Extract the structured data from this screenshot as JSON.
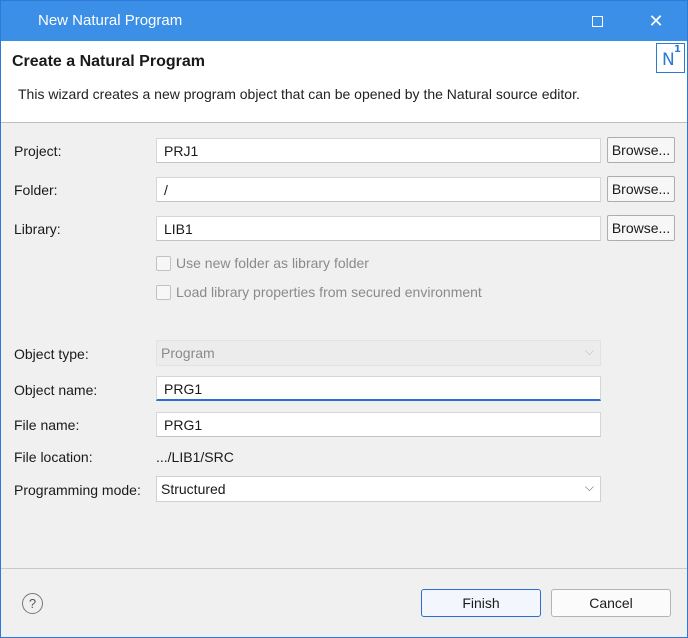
{
  "window": {
    "title": "New Natural Program",
    "close_glyph": "✕"
  },
  "header": {
    "title": "Create a Natural Program",
    "description": "This wizard creates a new program object that can be opened by the Natural source editor.",
    "logo_letter": "N",
    "logo_superscript": "1"
  },
  "form": {
    "project": {
      "label": "Project:",
      "value": "PRJ1",
      "browse_label": "Browse..."
    },
    "folder": {
      "label": "Folder:",
      "value": "/",
      "browse_label": "Browse..."
    },
    "library": {
      "label": "Library:",
      "value": "LIB1",
      "browse_label": "Browse..."
    },
    "use_new_folder": {
      "label": "Use new folder as library folder",
      "checked": false,
      "enabled": false
    },
    "load_library_props": {
      "label": "Load library properties from secured environment",
      "checked": false,
      "enabled": false
    },
    "object_type": {
      "label": "Object type:",
      "value": "Program",
      "enabled": false
    },
    "object_name": {
      "label": "Object name:",
      "value": "PRG1"
    },
    "file_name": {
      "label": "File name:",
      "value": "PRG1"
    },
    "file_location": {
      "label": "File location:",
      "value": ".../LIB1/SRC"
    },
    "programming_mode": {
      "label": "Programming mode:",
      "value": "Structured"
    }
  },
  "footer": {
    "help_glyph": "?",
    "finish_label": "Finish",
    "cancel_label": "Cancel"
  },
  "colors": {
    "titlebar": "#3b8fe6",
    "accent": "#2a6fd0"
  }
}
